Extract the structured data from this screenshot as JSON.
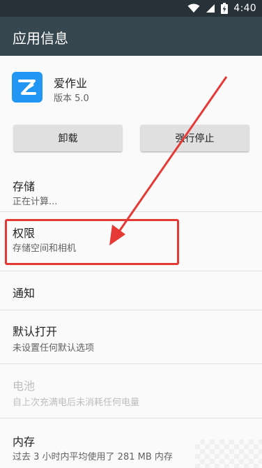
{
  "status_bar": {
    "time": "4:40",
    "icons": [
      "wifi-icon",
      "signal-icon",
      "battery-icon"
    ]
  },
  "app_bar": {
    "title": "应用信息"
  },
  "app": {
    "name": "爱作业",
    "version": "版本 5.0",
    "icon": "app-logo-icon"
  },
  "buttons": {
    "uninstall": "卸载",
    "force_stop": "强行停止"
  },
  "items": {
    "storage": {
      "title": "存储",
      "subtitle": "正在计算..."
    },
    "permissions": {
      "title": "权限",
      "subtitle": "存储空间和相机"
    },
    "notifications": {
      "title": "通知"
    },
    "open_by_default": {
      "title": "默认打开",
      "subtitle": "未设置任何默认选项"
    },
    "battery": {
      "title": "电池",
      "subtitle": "自上次充满电后未消耗任何电量"
    },
    "memory": {
      "title": "内存",
      "subtitle": "过去 3 小时内平均使用了 281 MB 内存"
    }
  },
  "colors": {
    "status_bar": "#263238",
    "app_bar": "#37474f",
    "app_icon": "#2196f3",
    "annotation": "#e53935"
  }
}
